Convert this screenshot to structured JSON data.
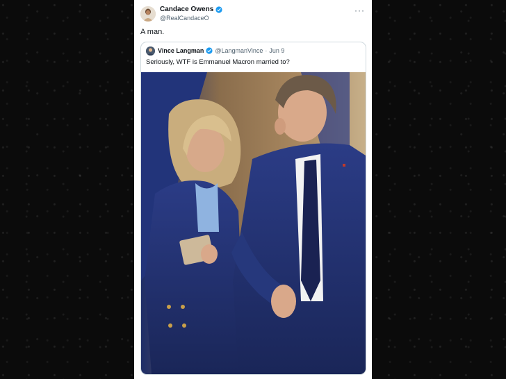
{
  "tweet": {
    "author_name": "Candace Owens",
    "author_handle": "@RealCandaceO",
    "text": "A man.",
    "more_label": "···"
  },
  "quoted_tweet": {
    "author_name": "Vince Langman",
    "author_handle": "@LangmanVince",
    "separator": "·",
    "date": "Jun 9",
    "text": "Seriously, WTF is Emmanuel Macron married to?"
  },
  "colors": {
    "verified_blue": "#1d9bf0",
    "background": "#0b0b0b",
    "card": "#ffffff",
    "suit_navy": "#1f2f6e"
  },
  "icons": {
    "verified": "verified-badge-icon",
    "more": "more-options-icon"
  }
}
